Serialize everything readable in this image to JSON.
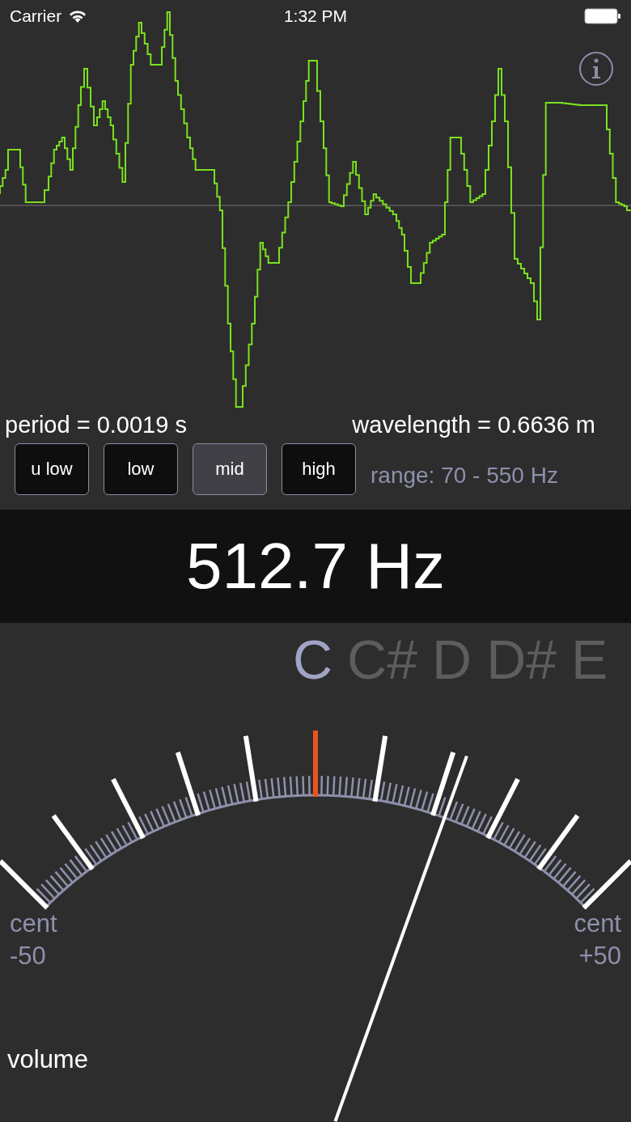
{
  "status_bar": {
    "carrier": "Carrier",
    "time": "1:32 PM"
  },
  "readings": {
    "period": "period = 0.0019 s",
    "wavelength": "wavelength = 0.6636 m"
  },
  "range_buttons": [
    {
      "label": "u low",
      "selected": false
    },
    {
      "label": "low",
      "selected": false
    },
    {
      "label": "mid",
      "selected": true
    },
    {
      "label": "high",
      "selected": false
    }
  ],
  "range": "range: 70 - 550 Hz",
  "frequency": "512.7 Hz",
  "notes": [
    {
      "label": "C",
      "selected": true
    },
    {
      "label": "C#",
      "selected": false
    },
    {
      "label": "D",
      "selected": false
    },
    {
      "label": "D#",
      "selected": false
    },
    {
      "label": "E",
      "selected": false
    }
  ],
  "meter": {
    "left_label": "cent",
    "left_value": "-50",
    "right_label": "cent",
    "right_value": "+50",
    "needle": {
      "level": 0.72
    }
  },
  "volume": {
    "label": "volume"
  }
}
